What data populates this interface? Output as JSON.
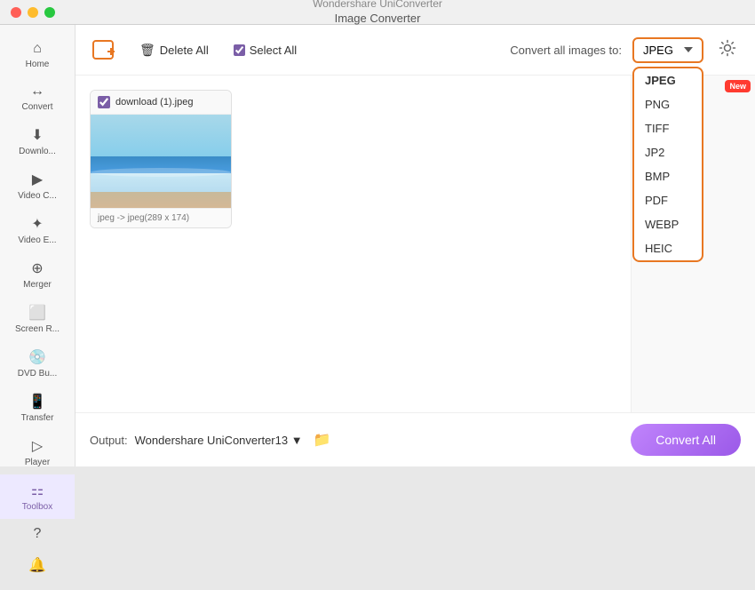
{
  "window": {
    "title": "Wondershare UniConverter",
    "subtitle": "Image Converter"
  },
  "titlebar": {
    "close": "close",
    "minimize": "minimize",
    "maximize": "maximize"
  },
  "sidebar": {
    "items": [
      {
        "id": "home",
        "label": "Home",
        "icon": "⌂"
      },
      {
        "id": "convert",
        "label": "Convert",
        "icon": "↔"
      },
      {
        "id": "download",
        "label": "Downlo...",
        "icon": "⬇"
      },
      {
        "id": "video-c",
        "label": "Video C...",
        "icon": "▶"
      },
      {
        "id": "video-e",
        "label": "Video E...",
        "icon": "✦"
      },
      {
        "id": "merger",
        "label": "Merger",
        "icon": "⊕"
      },
      {
        "id": "screen",
        "label": "Screen R...",
        "icon": "⬜"
      },
      {
        "id": "dvd",
        "label": "DVD Bu...",
        "icon": "💿"
      },
      {
        "id": "transfer",
        "label": "Transfer",
        "icon": "📱"
      },
      {
        "id": "player",
        "label": "Player",
        "icon": "▷"
      },
      {
        "id": "toolbox",
        "label": "Toolbox",
        "icon": "⚏",
        "active": true
      }
    ],
    "bottom": [
      {
        "id": "help",
        "icon": "?"
      },
      {
        "id": "bell",
        "icon": "🔔"
      }
    ]
  },
  "toolbar": {
    "delete_all": "Delete All",
    "select_all": "Select All",
    "convert_label": "Convert all images to:",
    "format": "JPEG"
  },
  "formats": {
    "options": [
      "JPEG",
      "PNG",
      "TIFF",
      "JP2",
      "BMP",
      "PDF",
      "WEBP",
      "HEIC"
    ],
    "selected": "JPEG"
  },
  "file": {
    "name": "download (1).jpeg",
    "info": "jpeg -> jpeg(289 x 174)",
    "checked": true
  },
  "footer": {
    "output_label": "Output:",
    "output_path": "Wondershare UniConverter13 ▼",
    "convert_all": "Convert All"
  },
  "new_badge": "New"
}
